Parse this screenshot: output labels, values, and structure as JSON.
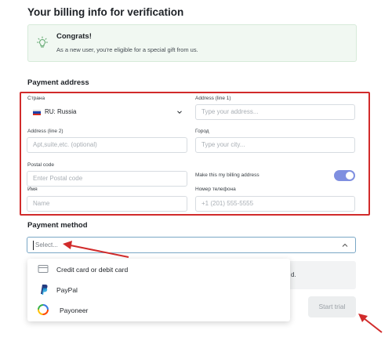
{
  "page": {
    "title": "Your billing info for verification"
  },
  "congrats": {
    "title": "Congrats!",
    "text": "As a new user, you're eligible for a special gift from us.",
    "icon": "lightbulb-icon"
  },
  "payment_address": {
    "title": "Payment address",
    "country": {
      "label": "Страна",
      "value": "RU: Russia",
      "flag": [
        "#ffffff",
        "#1c3fa8",
        "#d52b1e"
      ]
    },
    "address1": {
      "label": "Address (line 1)",
      "placeholder": "Type your address..."
    },
    "address2": {
      "label": "Address (line 2)",
      "placeholder": "Apt,suite,etc. (optional)"
    },
    "city": {
      "label": "Город",
      "placeholder": "Type your city..."
    },
    "postal": {
      "label": "Postal code",
      "placeholder": "Enter Postal code"
    },
    "billing_toggle": {
      "label": "Make this my billing address",
      "on": true
    },
    "name": {
      "label": "Имя",
      "placeholder": "Name"
    },
    "phone": {
      "label": "Номер телефона",
      "placeholder": "+1 (201) 555-5555"
    }
  },
  "payment_method": {
    "title": "Payment method",
    "placeholder": "Select...",
    "options": [
      {
        "label": "Credit card or debit card",
        "icon": "credit-card-icon"
      },
      {
        "label": "PayPal",
        "icon": "paypal-icon"
      },
      {
        "label": "Payoneer",
        "icon": "payoneer-icon"
      }
    ]
  },
  "hidden_note_tail": "d.",
  "start_trial": {
    "label": "Start trial"
  },
  "colors": {
    "accent": "#7f8fe0",
    "highlight_red": "#d12b2b",
    "congrats_bg": "#f1f8f2"
  }
}
